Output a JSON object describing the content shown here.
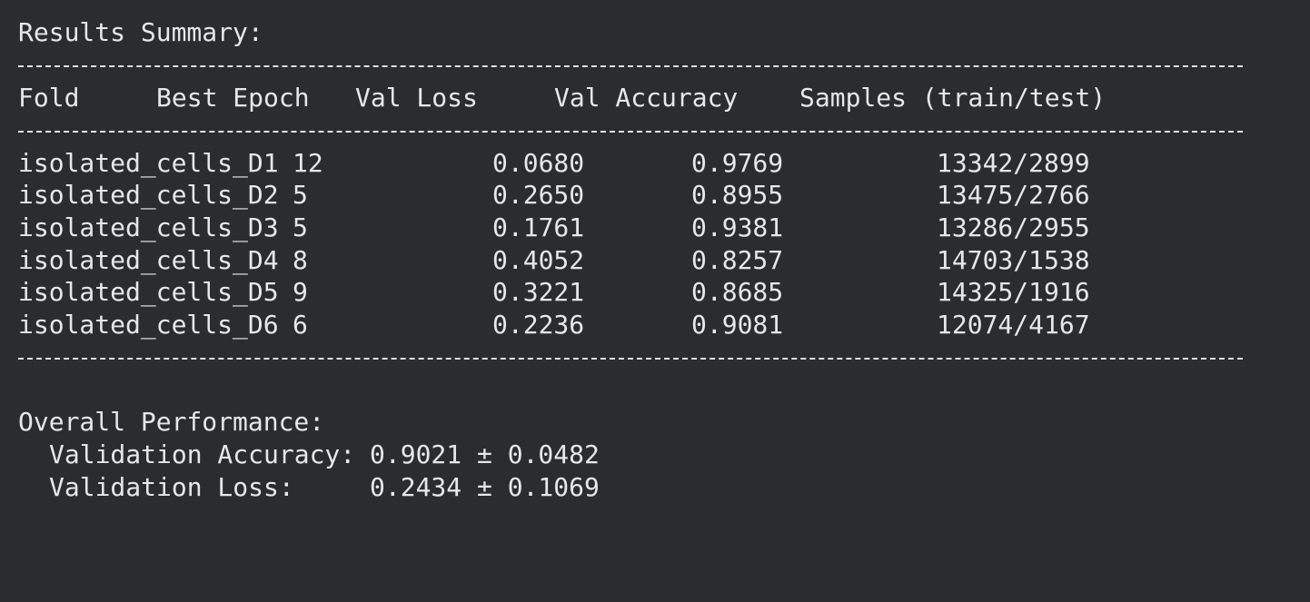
{
  "terminal": {
    "title": "Results Summary:",
    "table": {
      "headers": {
        "fold": "Fold",
        "best_epoch": "Best Epoch",
        "val_loss": "Val Loss",
        "val_accuracy": "Val Accuracy",
        "samples": "Samples (train/test)"
      },
      "rows": [
        {
          "fold": "isolated_cells_D1",
          "best_epoch": "12",
          "val_loss": "0.0680",
          "val_accuracy": "0.9769",
          "samples": "13342/2899"
        },
        {
          "fold": "isolated_cells_D2",
          "best_epoch": "5",
          "val_loss": "0.2650",
          "val_accuracy": "0.8955",
          "samples": "13475/2766"
        },
        {
          "fold": "isolated_cells_D3",
          "best_epoch": "5",
          "val_loss": "0.1761",
          "val_accuracy": "0.9381",
          "samples": "13286/2955"
        },
        {
          "fold": "isolated_cells_D4",
          "best_epoch": "8",
          "val_loss": "0.4052",
          "val_accuracy": "0.8257",
          "samples": "14703/1538"
        },
        {
          "fold": "isolated_cells_D5",
          "best_epoch": "9",
          "val_loss": "0.3221",
          "val_accuracy": "0.8685",
          "samples": "14325/1916"
        },
        {
          "fold": "isolated_cells_D6",
          "best_epoch": "6",
          "val_loss": "0.2236",
          "val_accuracy": "0.9081",
          "samples": "12074/4167"
        }
      ]
    },
    "overall": {
      "heading": "Overall Performance:",
      "accuracy_label": "Validation Accuracy:",
      "accuracy_value": "0.9021 ± 0.0482",
      "loss_label": "Validation Loss:",
      "loss_value": "0.2434 ± 0.1069"
    }
  }
}
